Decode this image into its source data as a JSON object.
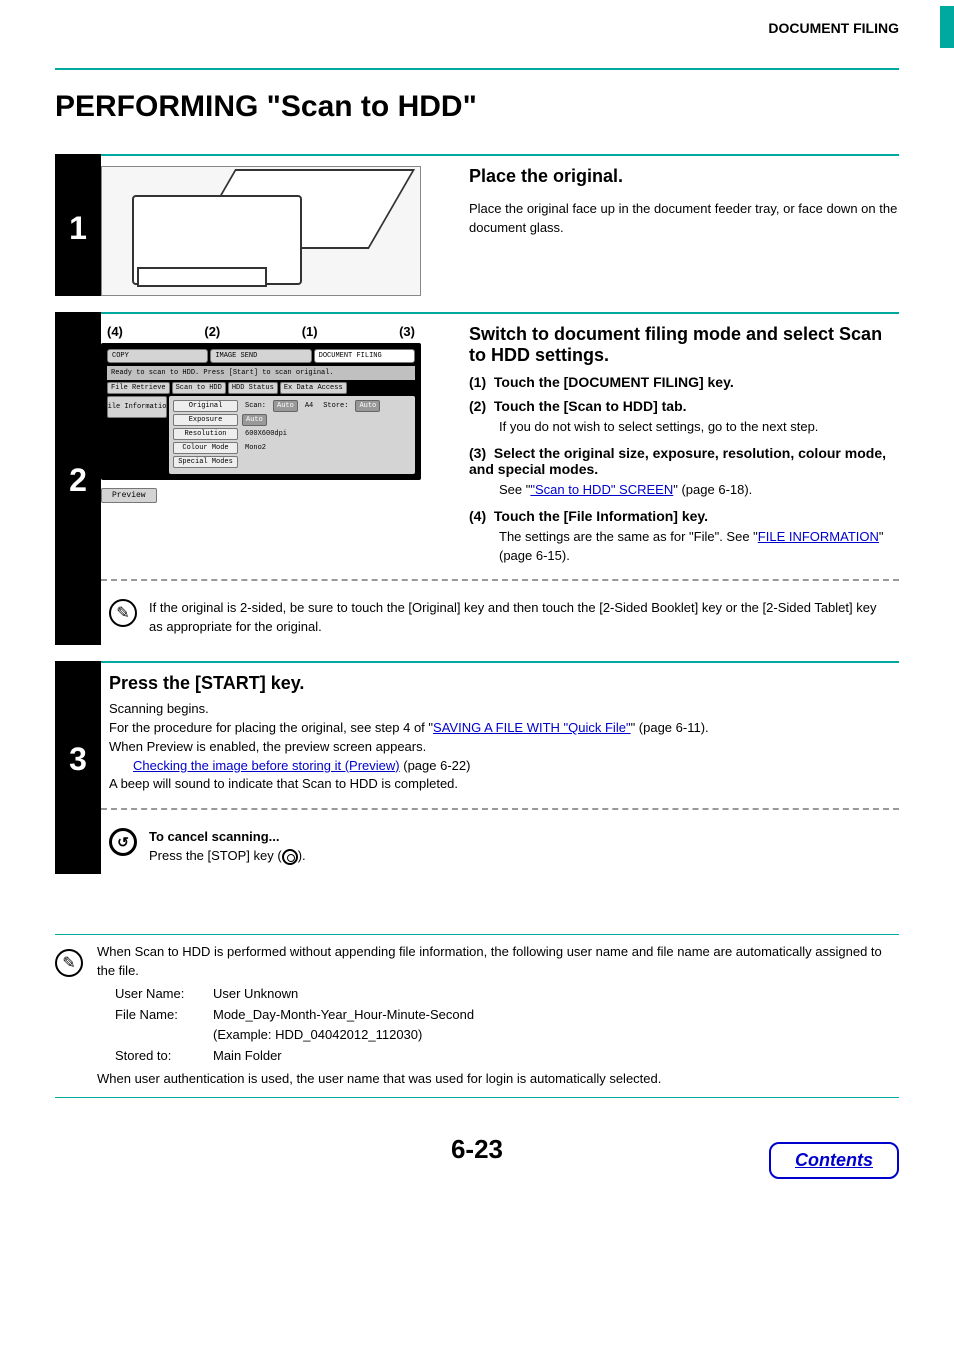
{
  "header": {
    "section": "DOCUMENT FILING"
  },
  "title": "PERFORMING \"Scan to HDD\"",
  "step1": {
    "num": "1",
    "title": "Place the original.",
    "text": "Place the original face up in the document feeder tray, or face down on the document glass."
  },
  "step2": {
    "num": "2",
    "title": "Switch to document filing mode and select Scan to HDD settings.",
    "callouts": {
      "c1": "(1)",
      "c2": "(2)",
      "c3": "(3)",
      "c4": "(4)"
    },
    "screen": {
      "tab_copy": "COPY",
      "tab_send": "IMAGE SEND",
      "tab_filing": "DOCUMENT FILING",
      "msg": "Ready to scan to HDD. Press [Start] to scan original.",
      "btn_retrieve": "File Retrieve",
      "btn_scan": "Scan to HDD",
      "btn_status": "HDD Status",
      "btn_ext": "Ex Data Access",
      "file_info": "File Information",
      "set_original": "Original",
      "set_scan_lbl": "Scan:",
      "set_scan_val": "Auto",
      "set_scan_size": "A4",
      "set_store_lbl": "Store:",
      "set_store_val": "Auto",
      "set_exposure": "Exposure",
      "set_exposure_val": "Auto",
      "set_resolution": "Resolution",
      "set_resolution_val": "600X600dpi",
      "set_colour": "Colour Mode",
      "set_colour_val": "Mono2",
      "set_special": "Special Modes",
      "preview": "Preview"
    },
    "sub1": {
      "label": "(1)",
      "head": "Touch the [DOCUMENT FILING] key."
    },
    "sub2": {
      "label": "(2)",
      "head": "Touch the [Scan to HDD] tab.",
      "body": "If you do not wish to select settings, go to the next step."
    },
    "sub3": {
      "label": "(3)",
      "head": "Select the original size, exposure, resolution, colour mode, and special modes.",
      "body_pre": "See \"",
      "link": "\"Scan to HDD\" SCREEN",
      "body_post": "\" (page 6-18)."
    },
    "sub4": {
      "label": "(4)",
      "head": "Touch the [File Information] key.",
      "body_pre": "The settings are the same as for \"File\". See \"",
      "link": "FILE INFORMATION",
      "body_post": "\" (page 6-15)."
    },
    "note": "If the original is 2-sided, be sure to touch the [Original] key and then touch the [2-Sided Booklet] key or the [2-Sided Tablet] key as appropriate for the original."
  },
  "step3": {
    "num": "3",
    "title": "Press the [START] key.",
    "line1": "Scanning begins.",
    "line2_pre": "For the procedure for placing the original, see step 4 of \"",
    "line2_link": "SAVING A FILE WITH \"Quick File\"",
    "line2_post": "\" (page 6-11).",
    "line3": "When Preview is enabled, the preview screen appears.",
    "line4_link": "Checking the image before storing it (Preview)",
    "line4_post": " (page 6-22)",
    "line5": "A beep will sound to indicate that Scan to HDD is completed.",
    "cancel_head": "To cancel scanning...",
    "cancel_body_pre": "Press the [STOP] key (",
    "cancel_body_post": ")."
  },
  "infobox": {
    "intro": "When Scan to HDD is performed without appending file information, the following user name and file name are automatically assigned to the file.",
    "row1_label": "User Name:",
    "row1_val": "User Unknown",
    "row2_label": "File Name:",
    "row2_val": "Mode_Day-Month-Year_Hour-Minute-Second",
    "row2_ex": "(Example: HDD_04042012_112030)",
    "row3_label": "Stored to:",
    "row3_val": "Main Folder",
    "outro": "When user authentication is used, the user name that was used for login is automatically selected."
  },
  "footer": {
    "page": "6-23",
    "contents": "Contents"
  }
}
